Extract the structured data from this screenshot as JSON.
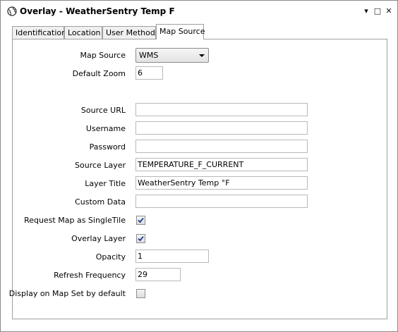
{
  "window": {
    "title": "Overlay - WeatherSentry Temp F",
    "pin_glyph": "▾",
    "maximize_glyph": "□",
    "close_glyph": "✕"
  },
  "tabs": [
    {
      "label": "Identification",
      "active": false
    },
    {
      "label": "Location",
      "active": false
    },
    {
      "label": "User Methods",
      "active": false
    },
    {
      "label": "Map Source",
      "active": true
    }
  ],
  "form": {
    "map_source": {
      "label": "Map Source",
      "value": "WMS"
    },
    "default_zoom": {
      "label": "Default Zoom",
      "value": "6"
    },
    "source_url": {
      "label": "Source URL",
      "value": ""
    },
    "username": {
      "label": "Username",
      "value": ""
    },
    "password": {
      "label": "Password",
      "value": ""
    },
    "source_layer": {
      "label": "Source Layer",
      "value": "TEMPERATURE_F_CURRENT"
    },
    "layer_title": {
      "label": "Layer Title",
      "value": "WeatherSentry Temp °F"
    },
    "custom_data": {
      "label": "Custom Data",
      "value": ""
    },
    "single_tile": {
      "label": "Request Map as SingleTile",
      "checked": true
    },
    "overlay_layer": {
      "label": "Overlay Layer",
      "checked": true
    },
    "opacity": {
      "label": "Opacity",
      "value": "1"
    },
    "refresh_frequency": {
      "label": "Refresh Frequency",
      "value": "29"
    },
    "display_default": {
      "label": "Display on Map Set by default",
      "checked": false
    }
  },
  "icons": {
    "app": "globe-icon",
    "pin": "pin-dropdown-icon",
    "maximize": "maximize-icon",
    "close": "close-icon",
    "check": "checkmark-icon"
  },
  "colors": {
    "check": "#1f3f8f",
    "border": "#a0a0a0"
  }
}
